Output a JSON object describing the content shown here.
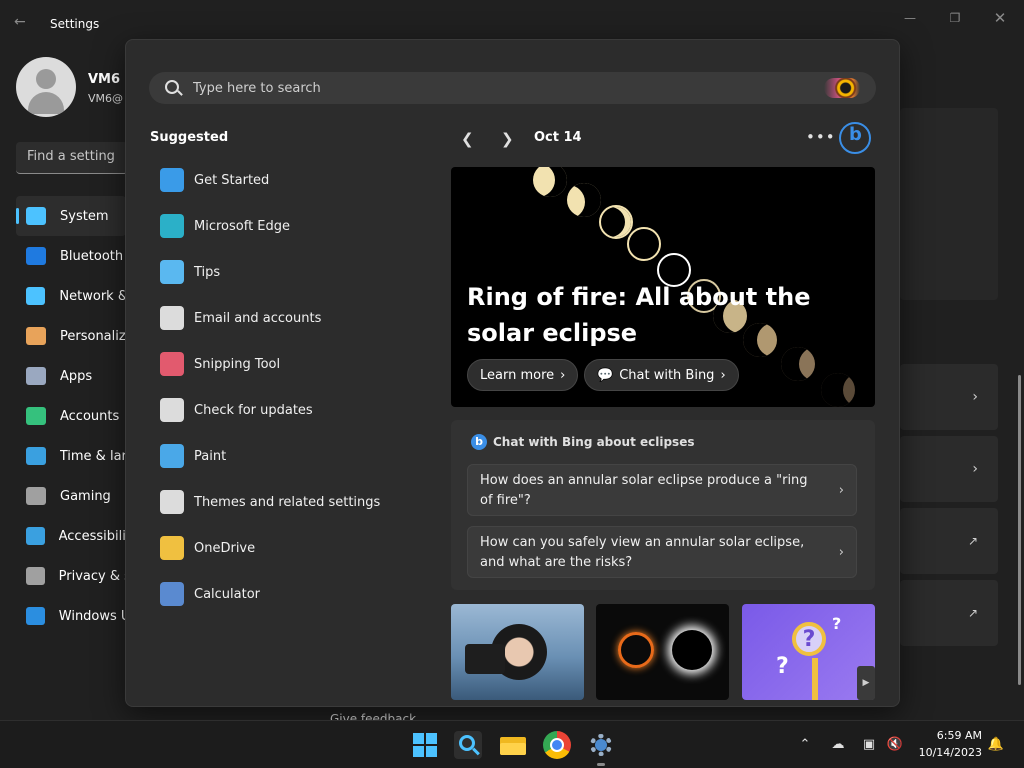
{
  "settings": {
    "app_title": "Settings",
    "user": {
      "name": "VM6",
      "email": "VM6@"
    },
    "find_placeholder": "Find a setting",
    "nav_items": [
      {
        "label": "System",
        "icon": "monitor-icon",
        "color": "#4cc2ff",
        "selected": true
      },
      {
        "label": "Bluetooth",
        "icon": "bluetooth-icon",
        "color": "#1f7ae0",
        "selected": false
      },
      {
        "label": "Network &",
        "icon": "wifi-icon",
        "color": "#4cc2ff",
        "selected": false
      },
      {
        "label": "Personaliz",
        "icon": "brush-icon",
        "color": "#e8a35a",
        "selected": false
      },
      {
        "label": "Apps",
        "icon": "apps-icon",
        "color": "#9aa8c0",
        "selected": false
      },
      {
        "label": "Accounts",
        "icon": "person-icon",
        "color": "#35c17d",
        "selected": false
      },
      {
        "label": "Time & lar",
        "icon": "clock-globe-icon",
        "color": "#3aa0e0",
        "selected": false
      },
      {
        "label": "Gaming",
        "icon": "controller-icon",
        "color": "#a0a0a0",
        "selected": false
      },
      {
        "label": "Accessibilit",
        "icon": "accessibility-icon",
        "color": "#3aa0e0",
        "selected": false
      },
      {
        "label": "Privacy & s",
        "icon": "shield-icon",
        "color": "#a0a0a0",
        "selected": false
      },
      {
        "label": "Windows U",
        "icon": "update-icon",
        "color": "#2b8ee0",
        "selected": false
      }
    ],
    "feedback_peek": "Give feedback"
  },
  "search": {
    "placeholder": "Type here to search",
    "suggested_title": "Suggested",
    "suggestions": [
      {
        "label": "Get Started",
        "icon": "get-started-icon",
        "color": "#3a9be8"
      },
      {
        "label": "Microsoft Edge",
        "icon": "edge-icon",
        "color": "#2bb0c8"
      },
      {
        "label": "Tips",
        "icon": "lightbulb-icon",
        "color": "#5ab8f0"
      },
      {
        "label": "Email and accounts",
        "icon": "mail-icon",
        "color": "#dcdcdc"
      },
      {
        "label": "Snipping Tool",
        "icon": "scissors-icon",
        "color": "#e25a6e"
      },
      {
        "label": "Check for updates",
        "icon": "refresh-icon",
        "color": "#dcdcdc"
      },
      {
        "label": "Paint",
        "icon": "palette-icon",
        "color": "#4aa8e8"
      },
      {
        "label": "Themes and related settings",
        "icon": "brush-icon",
        "color": "#dcdcdc"
      },
      {
        "label": "OneDrive",
        "icon": "onedrive-icon",
        "color": "#f0c040"
      },
      {
        "label": "Calculator",
        "icon": "calculator-icon",
        "color": "#5a8ad0"
      }
    ],
    "date": "Oct 14",
    "hero": {
      "title": "Ring of fire: All about the solar eclipse",
      "learn_more": "Learn more",
      "chat_with_bing": "Chat with Bing"
    },
    "chat": {
      "title": "Chat with Bing about eclipses",
      "questions": [
        "How does an annular solar eclipse produce a \"ring of fire\"?",
        "How can you safely view an annular solar eclipse, and what are the risks?"
      ]
    }
  },
  "taskbar": {
    "time": "6:59 AM",
    "date": "10/14/2023"
  },
  "colors": {
    "accent": "#4cc2ff",
    "bing_blue": "#3a8ee6",
    "flyout_bg": "#2c2c2c"
  }
}
